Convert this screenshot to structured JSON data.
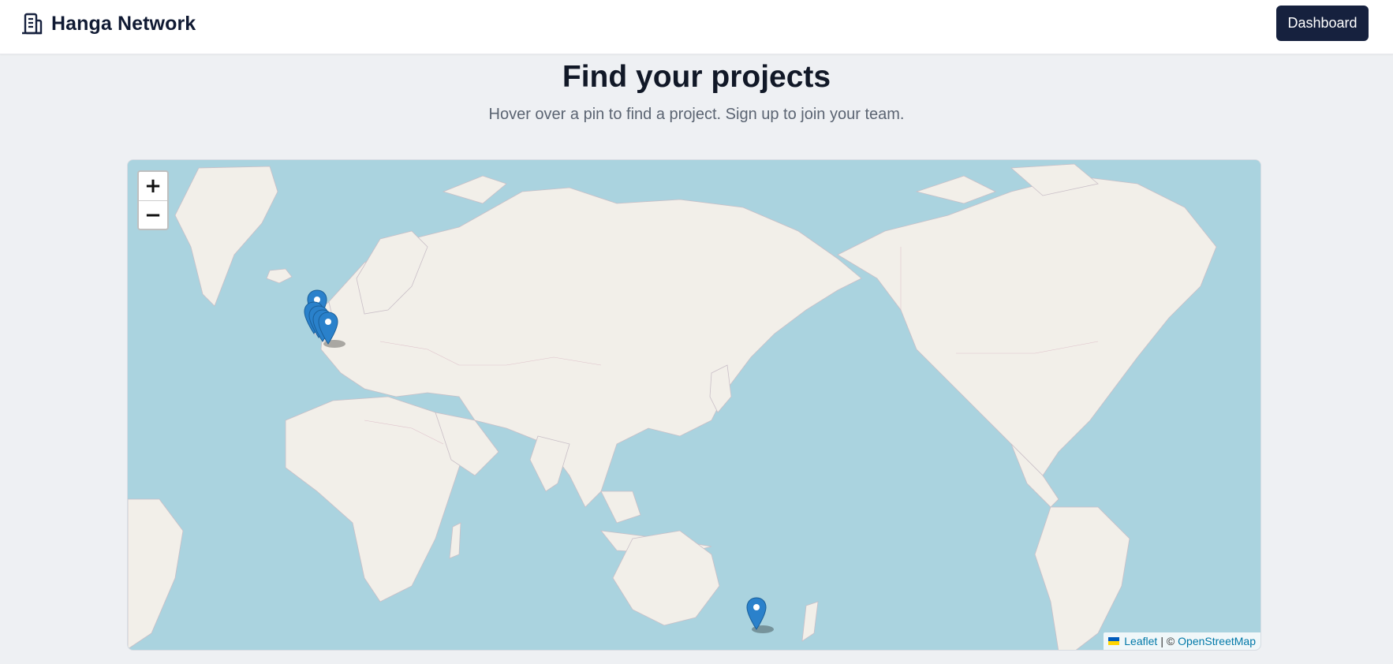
{
  "header": {
    "brand_name": "Hanga Network",
    "brand_icon": "building-icon",
    "dashboard_label": "Dashboard"
  },
  "hero": {
    "title": "Find your projects",
    "subtitle": "Hover over a pin to find a project. Sign up to join your team."
  },
  "map": {
    "zoom_in_label": "+",
    "zoom_out_label": "−",
    "attribution": {
      "leaflet_label": "Leaflet",
      "separator": "| ©",
      "osm_label": "OpenStreetMap"
    },
    "pins": [
      {
        "name": "project-pin",
        "region": "Ireland / UK"
      },
      {
        "name": "project-pin",
        "region": "Ireland / UK"
      },
      {
        "name": "project-pin",
        "region": "Ireland / UK"
      },
      {
        "name": "project-pin",
        "region": "Ireland / UK"
      },
      {
        "name": "project-pin",
        "region": "Ireland / UK"
      },
      {
        "name": "project-pin",
        "region": "Southeast Australia"
      }
    ]
  },
  "colors": {
    "ocean": "#aad3df",
    "land": "#f2efe9",
    "pin": "#2a81cb",
    "button_bg": "#16213e",
    "page_bg": "#eef0f3"
  }
}
